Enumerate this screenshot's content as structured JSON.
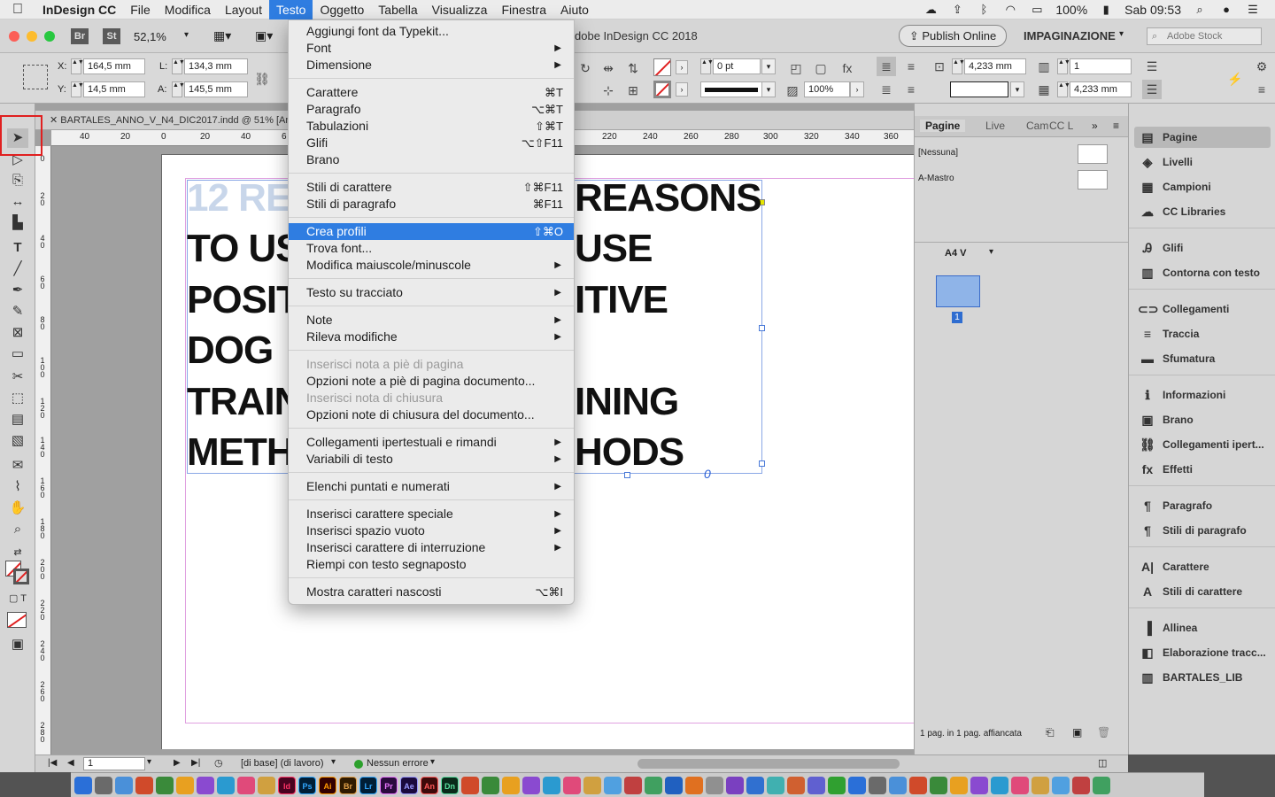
{
  "menubar": {
    "app_name": "InDesign CC",
    "items": [
      "File",
      "Modifica",
      "Layout",
      "Testo",
      "Oggetto",
      "Tabella",
      "Visualizza",
      "Finestra",
      "Aiuto"
    ],
    "active_item": "Testo",
    "battery": "100%",
    "clock": "Sab 09:53"
  },
  "appbar": {
    "bridge": "Br",
    "stock": "St",
    "zoom": "52,1%",
    "title_fragment": "dobe InDesign CC 2018",
    "publish_button": "Publish Online",
    "workspace": "IMPAGINAZIONE",
    "search_placeholder": "Adobe Stock"
  },
  "control": {
    "x_label": "X:",
    "x_value": "164,5 mm",
    "y_label": "Y:",
    "y_value": "14,5 mm",
    "w_label": "L:",
    "w_value": "134,3 mm",
    "h_label": "A:",
    "h_value": "145,5 mm",
    "stroke_weight": "0 pt",
    "opacity": "100%",
    "gutter_1": "4,233 mm",
    "gutter_2": "4,233 mm",
    "columns": "1"
  },
  "document": {
    "tab_title": "BARTALES_ANNO_V_N4_DIC2017.indd @ 51% [An",
    "ruler_ticks": [
      "40",
      "20",
      "0",
      "20",
      "40",
      "6",
      "220",
      "240",
      "260",
      "280",
      "300",
      "320",
      "340",
      "360"
    ],
    "vruler_ticks": [
      "0",
      "2\n0",
      "4\n0",
      "6\n0",
      "8\n0",
      "1\n0\n0",
      "1\n2\n0",
      "1\n4\n0",
      "1\n6\n0",
      "1\n8\n0",
      "2\n0\n0",
      "2\n2\n0",
      "2\n4\n0",
      "2\n6\n0",
      "2\n8\n0"
    ],
    "headline_left": [
      "12 RE",
      "TO US",
      "POSIT",
      "DOG",
      "TRAIN",
      "METH"
    ],
    "headline_right": [
      "REASONS",
      "USE",
      "ITIVE",
      "",
      "INING",
      "HODS"
    ],
    "overset_marker": "0"
  },
  "testo_menu": {
    "items": [
      {
        "label": "Aggiungi font da Typekit...",
        "shortcut": "",
        "submenu": false,
        "disabled": false
      },
      {
        "label": "Font",
        "shortcut": "",
        "submenu": true,
        "disabled": false
      },
      {
        "label": "Dimensione",
        "shortcut": "",
        "submenu": true,
        "disabled": false
      },
      {
        "label": "Carattere",
        "shortcut": "⌘T",
        "submenu": false,
        "disabled": false
      },
      {
        "label": "Paragrafo",
        "shortcut": "⌥⌘T",
        "submenu": false,
        "disabled": false
      },
      {
        "label": "Tabulazioni",
        "shortcut": "⇧⌘T",
        "submenu": false,
        "disabled": false
      },
      {
        "label": "Glifi",
        "shortcut": "⌥⇧F11",
        "submenu": false,
        "disabled": false
      },
      {
        "label": "Brano",
        "shortcut": "",
        "submenu": false,
        "disabled": false
      },
      {
        "label": "Stili di carattere",
        "shortcut": "⇧⌘F11",
        "submenu": false,
        "disabled": false
      },
      {
        "label": "Stili di paragrafo",
        "shortcut": "⌘F11",
        "submenu": false,
        "disabled": false
      },
      {
        "label": "Crea profili",
        "shortcut": "⇧⌘O",
        "submenu": false,
        "disabled": false,
        "highlighted": true
      },
      {
        "label": "Trova font...",
        "shortcut": "",
        "submenu": false,
        "disabled": false
      },
      {
        "label": "Modifica maiuscole/minuscole",
        "shortcut": "",
        "submenu": true,
        "disabled": false
      },
      {
        "label": "Testo su tracciato",
        "shortcut": "",
        "submenu": true,
        "disabled": false
      },
      {
        "label": "Note",
        "shortcut": "",
        "submenu": true,
        "disabled": false
      },
      {
        "label": "Rileva modifiche",
        "shortcut": "",
        "submenu": true,
        "disabled": false
      },
      {
        "label": "Inserisci nota a piè di pagina",
        "shortcut": "",
        "submenu": false,
        "disabled": true
      },
      {
        "label": "Opzioni note a piè di pagina documento...",
        "shortcut": "",
        "submenu": false,
        "disabled": false
      },
      {
        "label": "Inserisci nota di chiusura",
        "shortcut": "",
        "submenu": false,
        "disabled": true
      },
      {
        "label": "Opzioni note di chiusura del documento...",
        "shortcut": "",
        "submenu": false,
        "disabled": false
      },
      {
        "label": "Collegamenti ipertestuali e rimandi",
        "shortcut": "",
        "submenu": true,
        "disabled": false
      },
      {
        "label": "Variabili di testo",
        "shortcut": "",
        "submenu": true,
        "disabled": false
      },
      {
        "label": "Elenchi puntati e numerati",
        "shortcut": "",
        "submenu": true,
        "disabled": false
      },
      {
        "label": "Inserisci carattere speciale",
        "shortcut": "",
        "submenu": true,
        "disabled": false
      },
      {
        "label": "Inserisci spazio vuoto",
        "shortcut": "",
        "submenu": true,
        "disabled": false
      },
      {
        "label": "Inserisci carattere di interruzione",
        "shortcut": "",
        "submenu": true,
        "disabled": false
      },
      {
        "label": "Riempi con testo segnaposto",
        "shortcut": "",
        "submenu": false,
        "disabled": false
      },
      {
        "label": "Mostra caratteri nascosti",
        "shortcut": "⌥⌘I",
        "submenu": false,
        "disabled": false
      }
    ]
  },
  "pages_panel": {
    "tabs": [
      "Pagine",
      "Live",
      "Cam",
      "CC L"
    ],
    "masters": [
      "[Nessuna]",
      "A-Mastro"
    ],
    "page_size": "A4 V",
    "page_number": "1",
    "status": "1 pag. in 1 pag. affiancata"
  },
  "side_panel": {
    "groups": [
      [
        {
          "label": "Pagine",
          "icon": "pages-icon",
          "glyph": "▤"
        },
        {
          "label": "Livelli",
          "icon": "layers-icon",
          "glyph": "◈"
        },
        {
          "label": "Campioni",
          "icon": "swatches-icon",
          "glyph": "▦"
        },
        {
          "label": "CC Libraries",
          "icon": "cc-libraries-icon",
          "glyph": "☁"
        }
      ],
      [
        {
          "label": "Glifi",
          "icon": "glyphs-icon",
          "glyph": "Ꭿ"
        },
        {
          "label": "Contorna con testo",
          "icon": "text-wrap-icon",
          "glyph": "▥"
        }
      ],
      [
        {
          "label": "Collegamenti",
          "icon": "links-icon",
          "glyph": "⊂⊃"
        },
        {
          "label": "Traccia",
          "icon": "stroke-icon",
          "glyph": "≡"
        },
        {
          "label": "Sfumatura",
          "icon": "gradient-icon",
          "glyph": "▬"
        }
      ],
      [
        {
          "label": "Informazioni",
          "icon": "info-icon",
          "glyph": "ℹ"
        },
        {
          "label": "Brano",
          "icon": "story-icon",
          "glyph": "▣"
        },
        {
          "label": "Collegamenti ipert...",
          "icon": "hyperlinks-icon",
          "glyph": "⛓"
        },
        {
          "label": "Effetti",
          "icon": "effects-icon",
          "glyph": "fx"
        }
      ],
      [
        {
          "label": "Paragrafo",
          "icon": "paragraph-icon",
          "glyph": "¶"
        },
        {
          "label": "Stili di paragrafo",
          "icon": "paragraph-styles-icon",
          "glyph": "¶"
        }
      ],
      [
        {
          "label": "Carattere",
          "icon": "character-icon",
          "glyph": "A|"
        },
        {
          "label": "Stili di carattere",
          "icon": "character-styles-icon",
          "glyph": "A"
        }
      ],
      [
        {
          "label": "Allinea",
          "icon": "align-icon",
          "glyph": "▐"
        },
        {
          "label": "Elaborazione tracc...",
          "icon": "pathfinder-icon",
          "glyph": "◧"
        },
        {
          "label": "BARTALES_LIB",
          "icon": "library-icon",
          "glyph": "▥"
        }
      ]
    ]
  },
  "statusbar": {
    "page": "1",
    "profile": "[di base] (di lavoro)",
    "preflight": "Nessun errore"
  },
  "dock_apps": [
    "Id",
    "Ps",
    "Ai",
    "Br",
    "Lr",
    "Pr",
    "Ae",
    "An",
    "Dn"
  ],
  "colors": {
    "accent": "#2f7de1",
    "selection_frame": "#e0a0e0",
    "preflight_ok": "#2ca02c"
  }
}
